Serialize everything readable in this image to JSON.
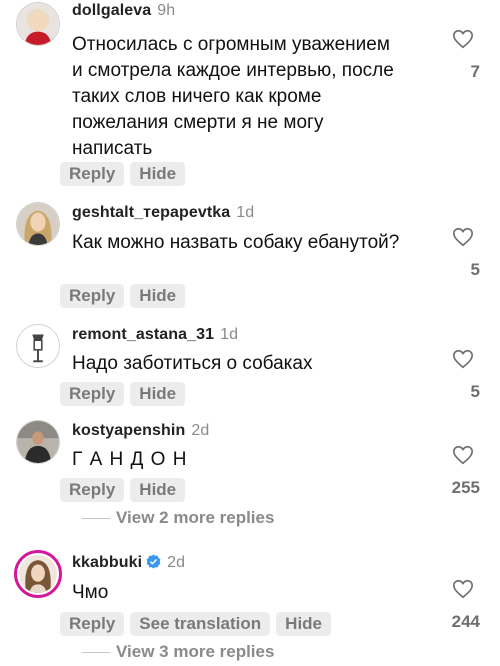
{
  "comments": [
    {
      "username": "dollgaleva",
      "time": "9h",
      "text": "Относилась с огромным уважением и смотрела каждое интервью, после таких слов ничего как кроме пожелания смерти я не могу написать",
      "actions": [
        "Reply",
        "Hide"
      ],
      "likes": "7",
      "avatar_icon": "avatar-girl-red-top"
    },
    {
      "username": "geshtalt_терapevtka",
      "time": "1d",
      "text": "Как можно назвать собаку ебанутой?",
      "actions": [
        "Reply",
        "Hide"
      ],
      "likes": "5",
      "avatar_icon": "avatar-girl-blonde"
    },
    {
      "username": "remont_astana_31",
      "time": "1d",
      "text": "Надо заботиться о собаках",
      "actions": [
        "Reply",
        "Hide"
      ],
      "likes": "5",
      "avatar_icon": "avatar-lamp"
    },
    {
      "username": "kostyapenshin",
      "time": "2d",
      "text": "Г А Н Д О Н",
      "actions": [
        "Reply",
        "Hide"
      ],
      "likes": "255",
      "view_replies": "View 2 more replies",
      "avatar_icon": "avatar-man-dark"
    },
    {
      "username": "kkabbuki",
      "time": "2d",
      "verified": true,
      "text": "Чмо",
      "actions": [
        "Reply",
        "See translation",
        "Hide"
      ],
      "likes": "244",
      "view_replies": "View 3 more replies",
      "avatar_icon": "avatar-girl-story"
    }
  ],
  "colors": {
    "story_ring": "#d3199a",
    "verified_badge": "#3897f0",
    "pill_bg": "#ececec",
    "muted_text": "#8a8a8a"
  }
}
